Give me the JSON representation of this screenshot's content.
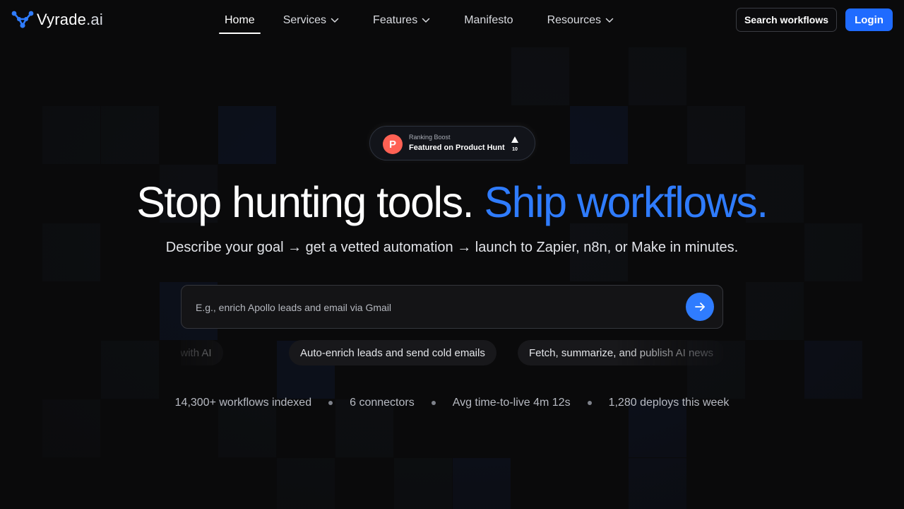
{
  "nav": {
    "logo_main": "Vyrade",
    "logo_suffix": ".ai",
    "links": [
      {
        "label": "Home",
        "active": true,
        "dropdown": false
      },
      {
        "label": "Services",
        "active": false,
        "dropdown": true
      },
      {
        "label": "Features",
        "active": false,
        "dropdown": true
      },
      {
        "label": "Manifesto",
        "active": false,
        "dropdown": false
      },
      {
        "label": "Resources",
        "active": false,
        "dropdown": true
      }
    ],
    "search_button": "Search workflows",
    "login_button": "Login"
  },
  "badge": {
    "icon_letter": "P",
    "small_text": "Ranking Boost",
    "main_text": "Featured on Product Hunt",
    "upvotes": "10"
  },
  "hero": {
    "headline_plain": "Stop hunting tools.",
    "headline_accent": "Ship workflows.",
    "subline": "Describe your goal → get a vetted automation → launch to Zapier, n8n, or Make in minutes."
  },
  "search": {
    "placeholder": "E.g., enrich Apollo leads and email via Gmail",
    "value": ""
  },
  "suggestions": [
    "ublishing with AI",
    "Auto-enrich leads and send cold emails",
    "Fetch, summarize, and publish AI news"
  ],
  "stats": [
    "14,300+ workflows indexed",
    "6 connectors",
    "Avg time-to-live 4m 12s",
    "1,280 deploys this week"
  ],
  "colors": {
    "background": "#0a0a0b",
    "accent": "#2f7cff",
    "login": "#1f6bff",
    "product_hunt": "#ff6154"
  }
}
